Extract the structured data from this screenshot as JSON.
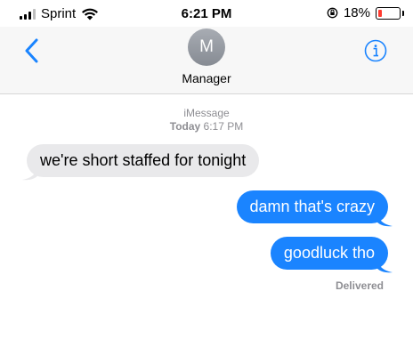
{
  "status_bar": {
    "carrier": "Sprint",
    "time": "6:21 PM",
    "battery_text": "18%",
    "battery_level": 0.18,
    "battery_color": "#ff3b30"
  },
  "nav": {
    "back_icon": "chevron-left-icon",
    "avatar_initial": "M",
    "contact_name": "Manager",
    "info_icon": "info-icon",
    "accent_color": "#1a84ff"
  },
  "thread": {
    "service": "iMessage",
    "day": "Today",
    "time": "6:17 PM"
  },
  "messages": [
    {
      "direction": "incoming",
      "text": "we're short staffed for tonight"
    },
    {
      "direction": "outgoing",
      "text": "damn that's crazy"
    },
    {
      "direction": "outgoing",
      "text": "goodluck tho"
    }
  ],
  "delivery_status": "Delivered"
}
